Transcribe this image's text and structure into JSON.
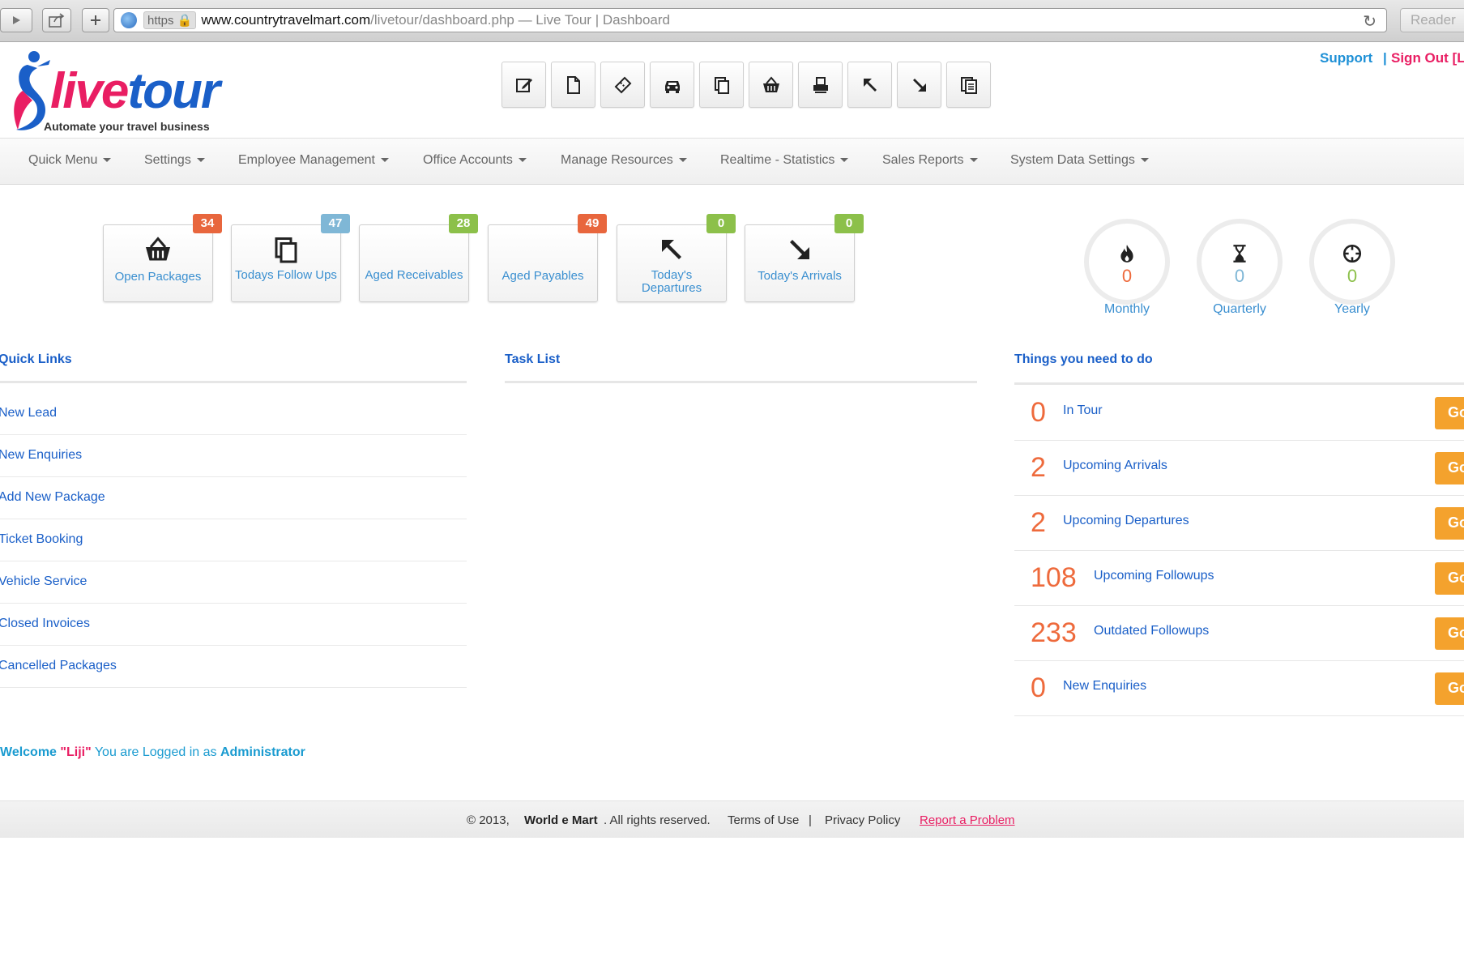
{
  "browser": {
    "url_scheme": "https",
    "url_domain": "www.countrytravelmart.com",
    "url_path": "/livetour/dashboard.php — Live Tour | Dashboard",
    "reader_label": "Reader"
  },
  "header": {
    "logo_live": "live",
    "logo_tour": "tour",
    "tagline": "Automate your travel business",
    "support_label": "Support",
    "separator": "|",
    "signout_label": "Sign Out [Li"
  },
  "toolbar_icons": [
    "edit-icon",
    "document-icon",
    "ticket-icon",
    "car-icon",
    "copy-icon",
    "basket-icon",
    "printer-icon",
    "arrow-up-left-icon",
    "arrow-down-right-icon",
    "documents-icon"
  ],
  "nav": {
    "items": [
      "Quick Menu",
      "Settings",
      "Employee Management",
      "Office Accounts",
      "Manage Resources",
      "Realtime - Statistics",
      "Sales Reports",
      "System Data Settings"
    ]
  },
  "tiles": [
    {
      "label": "Open Packages",
      "badge": "34",
      "badge_color": "#e8663d",
      "icon": "basket-icon"
    },
    {
      "label": "Todays Follow Ups",
      "badge": "47",
      "badge_color": "#7fb7d6",
      "icon": "copy-icon"
    },
    {
      "label": "Aged Receivables",
      "badge": "28",
      "badge_color": "#8cc04a",
      "icon": ""
    },
    {
      "label": "Aged Payables",
      "badge": "49",
      "badge_color": "#e8663d",
      "icon": ""
    },
    {
      "label": "Today's Departures",
      "badge": "0",
      "badge_color": "#8cc04a",
      "icon": "arrow-up-left-icon"
    },
    {
      "label": "Today's Arrivals",
      "badge": "0",
      "badge_color": "#8cc04a",
      "icon": "arrow-down-right-icon"
    }
  ],
  "stats": [
    {
      "label": "Monthly",
      "value": "0",
      "color": "#ee6a3c",
      "icon": "fire-icon"
    },
    {
      "label": "Quarterly",
      "value": "0",
      "color": "#7fb7d6",
      "icon": "hourglass-icon"
    },
    {
      "label": "Yearly",
      "value": "0",
      "color": "#8cc04a",
      "icon": "crosshair-icon"
    }
  ],
  "quick_links": {
    "title": "Quick Links",
    "items": [
      "New Lead",
      "New Enquiries",
      "Add New Package",
      "Ticket Booking",
      "Vehicle Service",
      "Closed Invoices",
      "Cancelled Packages"
    ]
  },
  "task_list": {
    "title": "Task List"
  },
  "todo": {
    "title": "Things you need to do",
    "go_label": "Go",
    "rows": [
      {
        "count": "0",
        "label": "In Tour"
      },
      {
        "count": "2",
        "label": "Upcoming Arrivals"
      },
      {
        "count": "2",
        "label": "Upcoming Departures"
      },
      {
        "count": "108",
        "label": "Upcoming Followups"
      },
      {
        "count": "233",
        "label": "Outdated Followups"
      },
      {
        "count": "0",
        "label": "New Enquiries"
      }
    ]
  },
  "welcome": {
    "prefix": "Welcome",
    "name": "\"Liji\"",
    "middle": "You are Logged in as",
    "role": "Administrator"
  },
  "footer": {
    "copyright": "© 2013,",
    "company": "World e Mart",
    "rights": ". All rights reserved.",
    "terms": "Terms of Use",
    "separator": "|",
    "privacy": "Privacy Policy",
    "report": "Report a Problem"
  }
}
